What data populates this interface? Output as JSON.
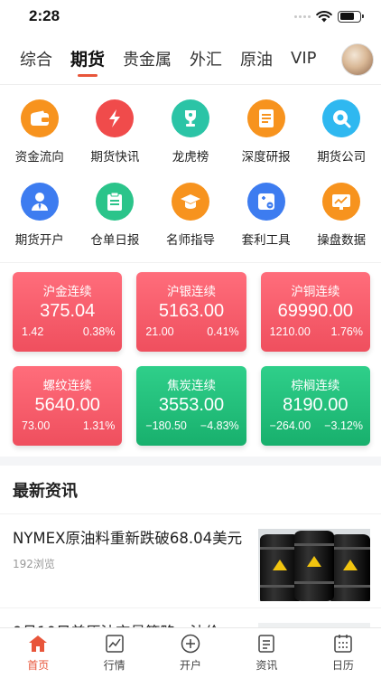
{
  "status": {
    "time": "2:28"
  },
  "tabs": [
    {
      "label": "综合",
      "active": false
    },
    {
      "label": "期货",
      "active": true
    },
    {
      "label": "贵金属",
      "active": false
    },
    {
      "label": "外汇",
      "active": false
    },
    {
      "label": "原油",
      "active": false
    },
    {
      "label": "VIP",
      "active": false
    }
  ],
  "features": [
    {
      "label": "资金流向",
      "icon": "wallet-icon",
      "color": "#f7931e"
    },
    {
      "label": "期货快讯",
      "icon": "flash-icon",
      "color": "#f04b4b"
    },
    {
      "label": "龙虎榜",
      "icon": "trophy-icon",
      "color": "#2bc4a6"
    },
    {
      "label": "深度研报",
      "icon": "report-icon",
      "color": "#f7931e"
    },
    {
      "label": "期货公司",
      "icon": "company-icon",
      "color": "#2fb8f0"
    },
    {
      "label": "期货开户",
      "icon": "account-icon",
      "color": "#3d7cf0"
    },
    {
      "label": "仓单日报",
      "icon": "clipboard-icon",
      "color": "#2bc48a"
    },
    {
      "label": "名师指导",
      "icon": "graduation-cap-icon",
      "color": "#f7931e"
    },
    {
      "label": "套利工具",
      "icon": "calculator-icon",
      "color": "#3d7cf0"
    },
    {
      "label": "操盘数据",
      "icon": "chart-board-icon",
      "color": "#f7931e"
    }
  ],
  "quotes": [
    {
      "name": "沪金连续",
      "price": "375.04",
      "change": "1.42",
      "percent": "0.38%",
      "trend": "up"
    },
    {
      "name": "沪银连续",
      "price": "5163.00",
      "change": "21.00",
      "percent": "0.41%",
      "trend": "up"
    },
    {
      "name": "沪铜连续",
      "price": "69990.00",
      "change": "1210.00",
      "percent": "1.76%",
      "trend": "up"
    },
    {
      "name": "螺纹连续",
      "price": "5640.00",
      "change": "73.00",
      "percent": "1.31%",
      "trend": "up"
    },
    {
      "name": "焦炭连续",
      "price": "3553.00",
      "change": "−180.50",
      "percent": "−4.83%",
      "trend": "down"
    },
    {
      "name": "棕榈连续",
      "price": "8190.00",
      "change": "−264.00",
      "percent": "−3.12%",
      "trend": "down"
    }
  ],
  "news": {
    "header": "最新资讯",
    "items": [
      {
        "title": "NYMEX原油料重新跌破68.04美元",
        "views": "192浏览"
      },
      {
        "title": "9月10日美原油交易策略：油价",
        "views": ""
      }
    ]
  },
  "bottom_nav": [
    {
      "label": "首页",
      "icon": "home-icon",
      "active": true
    },
    {
      "label": "行情",
      "icon": "market-chart-icon",
      "active": false
    },
    {
      "label": "开户",
      "icon": "plus-circle-icon",
      "active": false
    },
    {
      "label": "资讯",
      "icon": "news-icon",
      "active": false
    },
    {
      "label": "日历",
      "icon": "calendar-icon",
      "active": false
    }
  ],
  "colors": {
    "accent": "#e8553a",
    "up": "#ef4f5e",
    "down": "#18b06d"
  }
}
